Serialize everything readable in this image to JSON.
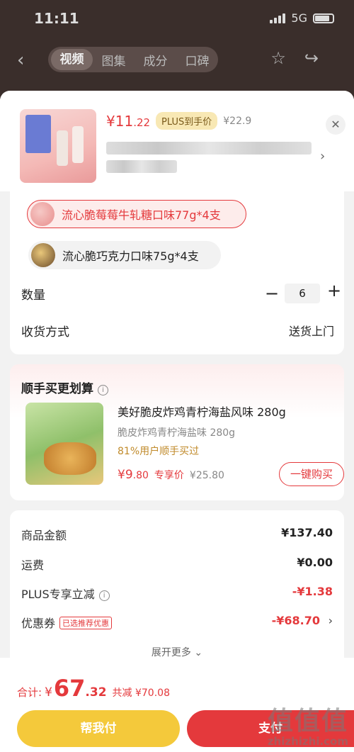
{
  "status_bar": {
    "time": "11:11",
    "network": "5G"
  },
  "navbar": {
    "tabs": [
      {
        "label": "视频",
        "active": true
      },
      {
        "label": "图集",
        "active": false
      },
      {
        "label": "成分",
        "active": false
      },
      {
        "label": "口碑",
        "active": false
      }
    ],
    "icons": [
      "back-icon",
      "star-icon",
      "share-icon"
    ]
  },
  "product": {
    "price_yen": "¥",
    "price_int": "11",
    "price_dec": ".22",
    "plus_badge": "PLUS到手价",
    "orig_price": "¥22.9"
  },
  "options": {
    "variants": [
      {
        "label": "流心脆莓莓牛轧糖口味77g*4支",
        "selected": true
      },
      {
        "label": "流心脆巧克力口味75g*4支",
        "selected": false
      }
    ],
    "qty_label": "数量",
    "qty_value": "6",
    "ship_label": "收货方式",
    "ship_value": "送货上门"
  },
  "addon": {
    "title": "顺手买更划算",
    "name": "美好脆皮炸鸡青柠海盐风味 280g",
    "subtitle": "脆皮炸鸡青柠海盐味 280g",
    "bought": "81%用户顺手买过",
    "price_yen": "¥",
    "price_int": "9",
    "price_dec": ".80",
    "price_tag": "专享价",
    "orig_price": "¥25.80",
    "buy_label": "一键购买"
  },
  "summary": {
    "rows": [
      {
        "label": "商品金额",
        "value": "¥137.40"
      },
      {
        "label": "运费",
        "value": "¥0.00"
      },
      {
        "label": "PLUS专享立减",
        "value": "-¥1.38"
      },
      {
        "label": "优惠券",
        "value": "-¥68.70",
        "tag": "已选推荐优惠"
      }
    ],
    "expand_label": "展开更多"
  },
  "bottom": {
    "total_label": "合计:",
    "total_yen": "¥",
    "total_int": "67",
    "total_dec": ".32",
    "discount": "共减 ¥70.08",
    "help_btn": "帮我付",
    "pay_btn": "支付"
  },
  "watermark": {
    "main": "值值值",
    "sub": "zhizhizhi.com"
  },
  "colors": {
    "accent": "#e4393c",
    "plus": "#f8e8b4",
    "help_btn": "#f4c93b"
  }
}
